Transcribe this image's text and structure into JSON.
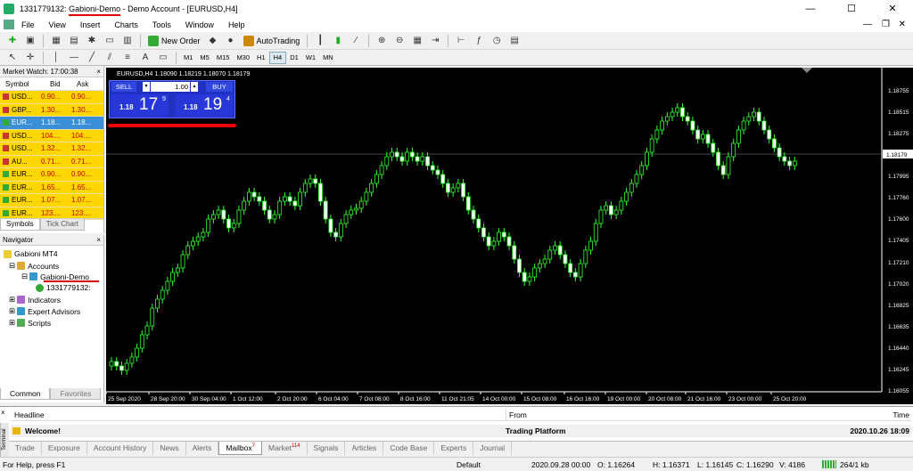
{
  "window": {
    "title_prefix": "1331779132: ",
    "title_account": "Gabioni-Demo",
    "title_suffix": " - Demo Account - [EURUSD,H4]",
    "minimize": "—",
    "maximize": "☐",
    "close": "✕"
  },
  "menu": [
    "File",
    "View",
    "Insert",
    "Charts",
    "Tools",
    "Window",
    "Help"
  ],
  "toolbar": {
    "new_order": "New Order",
    "auto_trading": "AutoTrading",
    "timeframes": [
      "M1",
      "M5",
      "M15",
      "M30",
      "H1",
      "H4",
      "D1",
      "W1",
      "MN"
    ],
    "selected_timeframe": "H4"
  },
  "market_watch": {
    "title": "Market Watch: 17:00:38",
    "close": "×",
    "columns": [
      "Symbol",
      "Bid",
      "Ask"
    ],
    "rows": [
      {
        "symbol": "USD...",
        "bid": "0.90...",
        "ask": "0.90...",
        "arrow": "#c33"
      },
      {
        "symbol": "GBP...",
        "bid": "1.30...",
        "ask": "1.30...",
        "arrow": "#c33"
      },
      {
        "symbol": "EUR...",
        "bid": "1.18...",
        "ask": "1.18...",
        "arrow": "#3a3",
        "selected": true
      },
      {
        "symbol": "USD...",
        "bid": "104....",
        "ask": "104....",
        "arrow": "#c33"
      },
      {
        "symbol": "USD...",
        "bid": "1.32...",
        "ask": "1.32...",
        "arrow": "#c33"
      },
      {
        "symbol": "AU...",
        "bid": "0.71...",
        "ask": "0.71...",
        "arrow": "#c33"
      },
      {
        "symbol": "EUR...",
        "bid": "0.90...",
        "ask": "0.90...",
        "arrow": "#3a3"
      },
      {
        "symbol": "EUR...",
        "bid": "1.65...",
        "ask": "1.65...",
        "arrow": "#3a3"
      },
      {
        "symbol": "EUR...",
        "bid": "1.07...",
        "ask": "1.07...",
        "arrow": "#3a3"
      },
      {
        "symbol": "EUR...",
        "bid": "123....",
        "ask": "123....",
        "arrow": "#3a3"
      }
    ],
    "tabs": [
      "Symbols",
      "Tick Chart"
    ]
  },
  "navigator": {
    "title": "Navigator",
    "close": "×",
    "root": "Gabioni MT4",
    "accounts": "Accounts",
    "server": "Gabioni-Demo",
    "account_number": "1331779132:",
    "indicators": "Indicators",
    "experts": "Expert Advisors",
    "scripts": "Scripts",
    "tabs": [
      "Common",
      "Favorites"
    ]
  },
  "chart": {
    "header": "EURUSD,H4  1.18090 1.18219 1.18070 1.18179",
    "one_click": {
      "sell": "SELL",
      "buy": "BUY",
      "lot": "1.00",
      "sell_big": "1.18",
      "sell_pips": "17",
      "sell_sup": "9",
      "buy_big": "1.18",
      "buy_pips": "19",
      "buy_sup": "4"
    },
    "price_labels": [
      "1.18755",
      "1.18515",
      "1.18275",
      "1.18179",
      "1.17995",
      "1.17760",
      "1.17600",
      "1.17405",
      "1.17210",
      "1.17020",
      "1.16825",
      "1.16635",
      "1.16440",
      "1.16245",
      "1.16055"
    ],
    "current_price": "1.18179",
    "time_labels": [
      "25 Sep 2020",
      "28 Sep 20:00",
      "30 Sep 04:00",
      "1 Oct 12:00",
      "2 Oct 20:00",
      "6 Oct 04:00",
      "7 Oct 08:00",
      "8 Oct 16:00",
      "11 Oct 21:05",
      "14 Oct 00:00",
      "15 Oct 08:00",
      "16 Oct 16:00",
      "19 Oct 00:00",
      "20 Oct 08:00",
      "21 Oct 16:00",
      "23 Oct 00:00",
      "25 Oct 20:00"
    ]
  },
  "terminal": {
    "side_label": "Terminal",
    "columns": [
      "Headline",
      "From",
      "Time"
    ],
    "row": {
      "headline": "Welcome!",
      "from": "Trading Platform",
      "time": "2020.10.26 18:09"
    },
    "tabs": [
      {
        "label": "Trade"
      },
      {
        "label": "Exposure"
      },
      {
        "label": "Account History"
      },
      {
        "label": "News"
      },
      {
        "label": "Alerts"
      },
      {
        "label": "Mailbox",
        "badge": "7",
        "active": true
      },
      {
        "label": "Market",
        "badge": "114"
      },
      {
        "label": "Signals"
      },
      {
        "label": "Articles"
      },
      {
        "label": "Code Base"
      },
      {
        "label": "Experts"
      },
      {
        "label": "Journal"
      }
    ]
  },
  "status": {
    "help": "For Help, press F1",
    "profile": "Default",
    "datetime": "2020.09.28 00:00",
    "open": "O: 1.16264",
    "high": "H: 1.16371",
    "low": "L: 1.16145",
    "close": "C: 1.16290",
    "volume": "V: 4186",
    "traffic": "264/1 kb"
  }
}
